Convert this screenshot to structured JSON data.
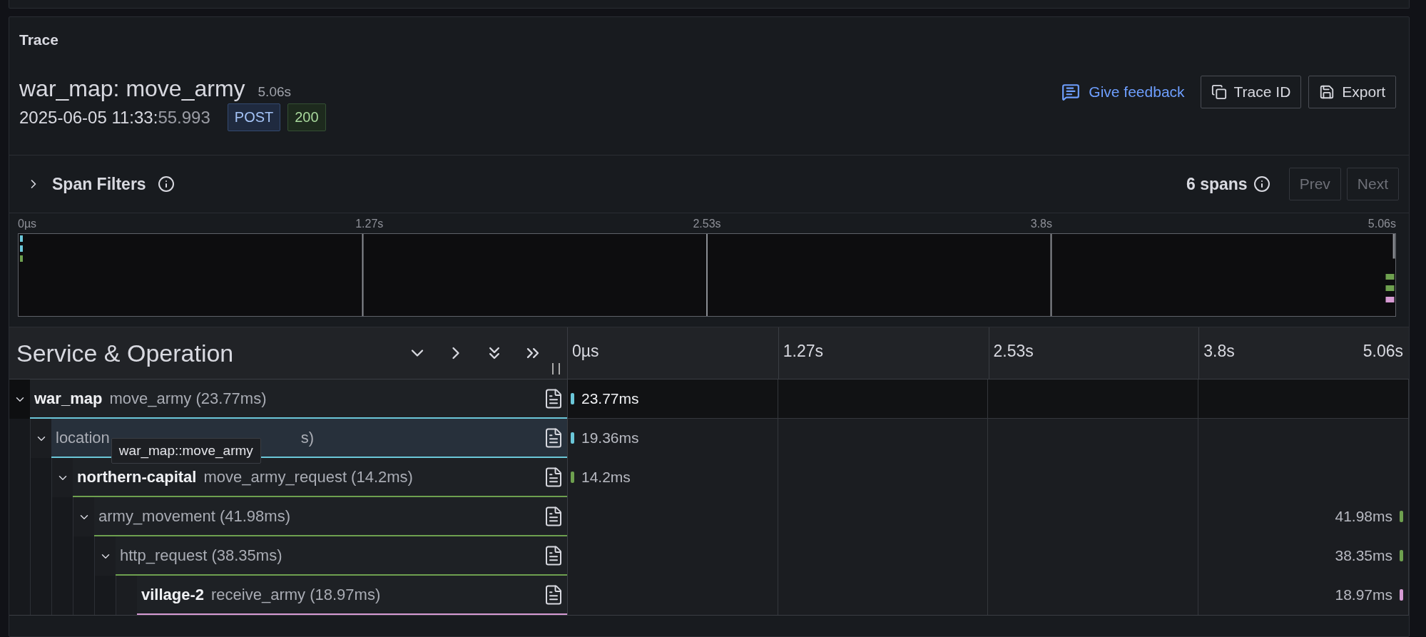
{
  "panel_title": "Trace",
  "trace": {
    "name": "war_map: move_army",
    "duration": "5.06s",
    "date": "2025-06-05 11:33:",
    "date_fraction": "55.993",
    "method": "POST",
    "status": "200"
  },
  "actions": [
    {
      "kind": "link",
      "label": "Give feedback"
    },
    {
      "kind": "copy",
      "label": "Trace ID"
    },
    {
      "kind": "save",
      "label": "Export"
    }
  ],
  "span_filters": {
    "label": "Span Filters",
    "expanded": false,
    "count": "6 spans",
    "buttons": [
      {
        "label": "Prev",
        "disabled": true
      },
      {
        "label": "Next",
        "disabled": true
      }
    ]
  },
  "minimap": {
    "ticks": [
      "0µs",
      "1.27s",
      "2.53s",
      "3.8s",
      "5.06s"
    ]
  },
  "table": {
    "column_title": "Service & Operation",
    "ticks": [
      "0µs",
      "1.27s",
      "2.53s",
      "3.8s",
      "5.06s"
    ],
    "spans": [
      {
        "service": "war_map",
        "operation": "move_army (23.77ms)",
        "color": "#6bc7d9",
        "expanded": true,
        "selected": true,
        "hovered": false,
        "kind": "start",
        "bar_label": "23.77ms",
        "children": [
          {
            "operation": "location",
            "operation_tail": "s)",
            "tooltip": "war_map::move_army",
            "color": "#6bc7d9",
            "expanded": true,
            "selected": false,
            "hovered": true,
            "kind": "start",
            "bar_label": "19.36ms",
            "children": [
              {
                "service": "northern-capital",
                "operation": "move_army_request (14.2ms)",
                "color": "#6ea04f",
                "expanded": true,
                "selected": false,
                "hovered": false,
                "kind": "start",
                "bar_label": "14.2ms",
                "children": [
                  {
                    "operation": "army_movement (41.98ms)",
                    "color": "#6ea04f",
                    "expanded": true,
                    "selected": false,
                    "hovered": false,
                    "kind": "end",
                    "bar_label": "41.98ms",
                    "children": [
                      {
                        "operation": "http_request (38.35ms)",
                        "color": "#6ea04f",
                        "expanded": true,
                        "selected": false,
                        "hovered": false,
                        "kind": "end",
                        "bar_label": "38.35ms",
                        "children": [
                          {
                            "service": "village-2",
                            "operation": "receive_army (18.97ms)",
                            "color": "#d69ad3",
                            "selected": false,
                            "hovered": false,
                            "kind": "end",
                            "bar_label": "18.97ms"
                          }
                        ]
                      }
                    ]
                  }
                ]
              }
            ]
          }
        ]
      }
    ]
  }
}
